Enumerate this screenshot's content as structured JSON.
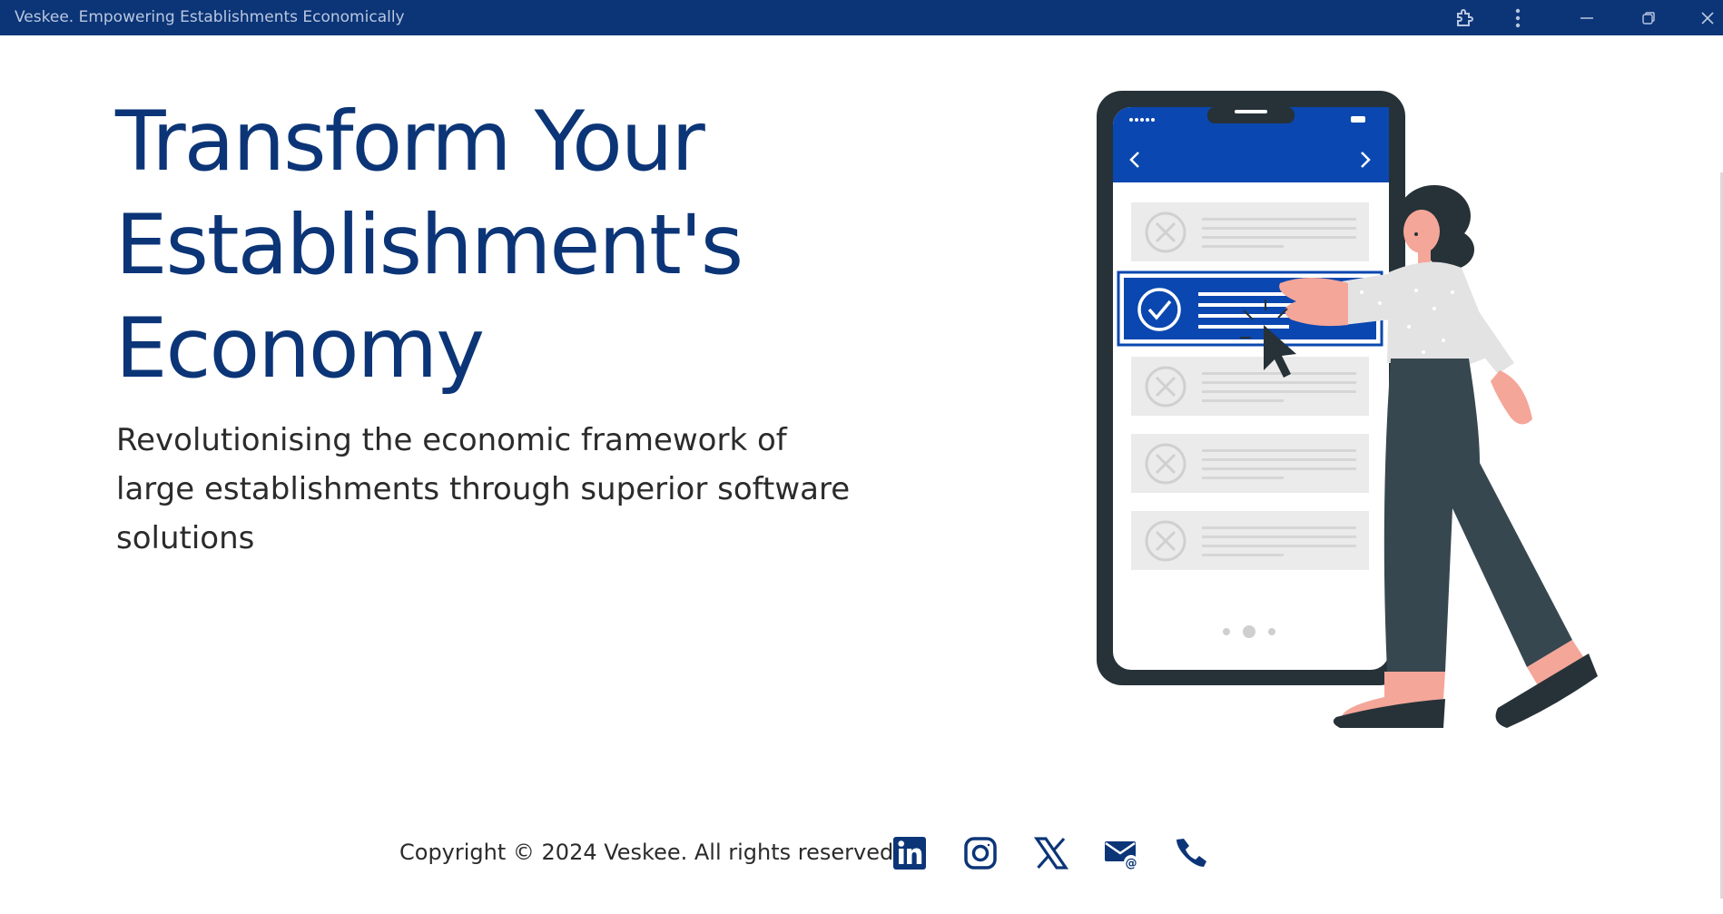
{
  "window": {
    "title": "Veskee. Empowering Establishments Economically",
    "controls": [
      "extensions-icon",
      "more-menu-icon",
      "minimize-icon",
      "restore-icon",
      "close-icon"
    ]
  },
  "hero": {
    "title_lines": [
      "Transform Your",
      "Establishment's",
      "Economy"
    ],
    "subtitle_lines": [
      "Revolutionising the economic framework of",
      "large establishments through superior software",
      "solutions"
    ]
  },
  "footer": {
    "copyright": "Copyright © 2024 Veskee. All rights reserved",
    "social_icons": [
      "linkedin-icon",
      "instagram-icon",
      "x-icon",
      "email-icon",
      "phone-icon"
    ]
  },
  "colors": {
    "brand_navy": "#0c3577",
    "accent_blue": "#0a47b0",
    "titlebar": "#0c3577",
    "text": "#2b2b2b"
  }
}
